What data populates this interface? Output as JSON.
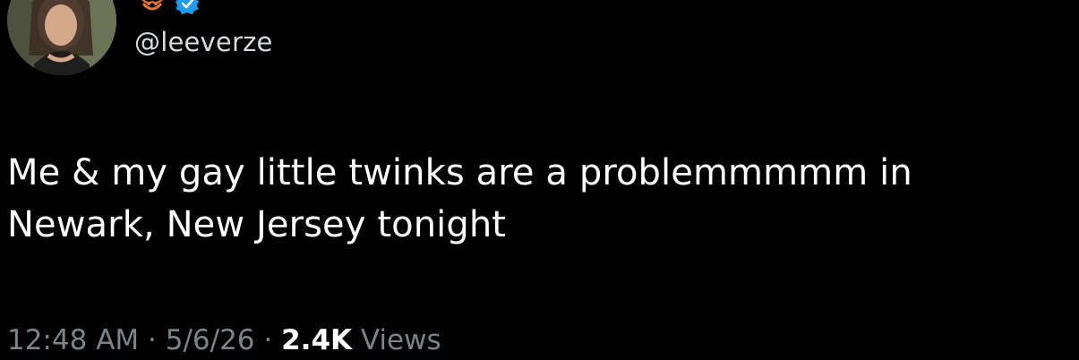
{
  "tweet": {
    "handle": "@leeverze",
    "text_lines": [
      "Me & my gay little twinks are a problemmmmm in",
      "Newark, New Jersey tonight"
    ],
    "time": "12:48 AM",
    "separator": "·",
    "date": "5/6/26",
    "views_count": "2.4K",
    "views_label": "Views"
  },
  "icons": {
    "avatar": "profile-photo",
    "emoji": "lobster-emoji-icon",
    "verified": "verified-badge-icon"
  },
  "colors": {
    "background": "#000000",
    "text": "#ffffff",
    "secondary_text": "#7d8287",
    "verified_blue": "#1d9bf0"
  }
}
